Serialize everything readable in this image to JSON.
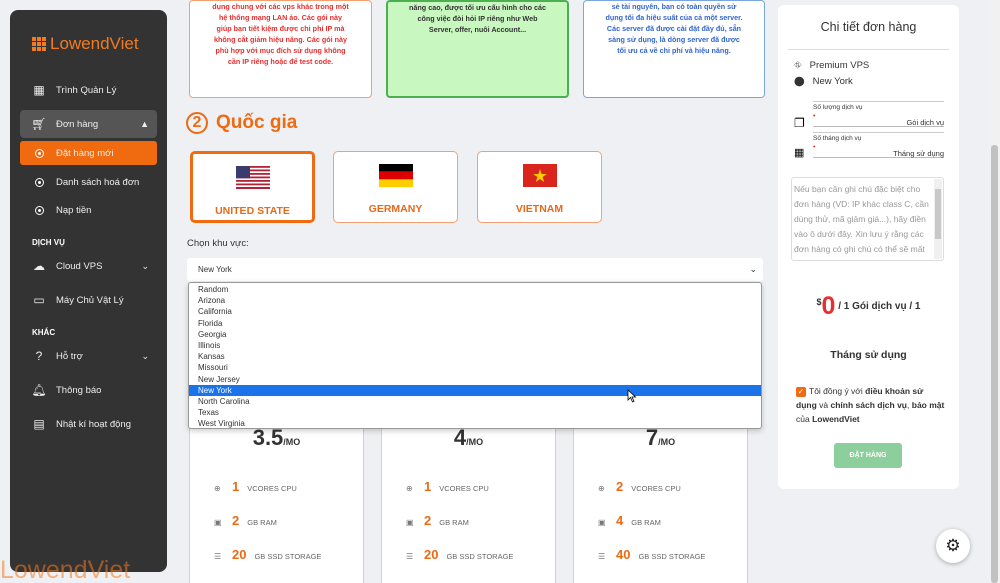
{
  "sidebar": {
    "logo": "LowendViet",
    "items": [
      {
        "label": "Trình Quản Lý",
        "icon": "dashboard-icon"
      },
      {
        "label": "Đơn hàng",
        "icon": "cart-icon"
      },
      {
        "label": "Đặt hàng mới",
        "icon": "radio-icon"
      },
      {
        "label": "Danh sách hoá đơn",
        "icon": "radio-icon"
      },
      {
        "label": "Nạp tiền",
        "icon": "radio-icon"
      },
      {
        "label": "Cloud VPS",
        "icon": "cloud-icon"
      },
      {
        "label": "Máy Chủ Vật Lý",
        "icon": "server-icon"
      },
      {
        "label": "Hỗ trợ",
        "icon": "help-icon"
      },
      {
        "label": "Thông báo",
        "icon": "bell-icon"
      },
      {
        "label": "Nhật kí hoạt động",
        "icon": "calendar-icon"
      }
    ],
    "sections": [
      "DỊCH VỤ",
      "KHÁC"
    ],
    "watermark": "LowendViet"
  },
  "plans_top": [
    {
      "lines": [
        "dụng chung với các vps khác trong một",
        "hệ thống mạng LAN ảo. Các gói này",
        "giúp bạn tiết kiệm được chi phí IP mà",
        "không cắt giảm hiệu năng. Các gói này",
        "phù hợp với mục đích sử dụng không",
        "cần IP riêng hoặc để test code."
      ],
      "color": "#e53030"
    },
    {
      "lines": [
        "năng cao, được tối ưu cấu hình cho các",
        "công việc đòi hỏi IP riêng như Web",
        "Server, offer, nuôi Account..."
      ],
      "color": "#333333"
    },
    {
      "lines": [
        "sẻ tài nguyên, bạn có toàn quyền sử",
        "dụng tối đa hiệu suất của cả một server.",
        "Các server đã được cài đặt đầy đủ, sẵn",
        "sàng sử dụng, là dòng server đã được",
        "tối ưu cả về chi phí và hiệu năng."
      ],
      "color": "#3366cc"
    }
  ],
  "country_section": {
    "number": "2",
    "title": "Quốc gia"
  },
  "countries": [
    {
      "name": "UNITED STATE",
      "flag": "us-flag-icon",
      "selected": true
    },
    {
      "name": "GERMANY",
      "flag": "de-flag-icon",
      "selected": false
    },
    {
      "name": "VIETNAM",
      "flag": "vn-flag-icon",
      "selected": false
    }
  ],
  "region": {
    "label": "Chọn khu vực:",
    "selected": "New York",
    "options": [
      "Random",
      "Arizona",
      "California",
      "Florida",
      "Georgia",
      "Illinois",
      "Kansas",
      "Missouri",
      "New Jersey",
      "New York",
      "North Carolina",
      "Texas",
      "West Virginia"
    ]
  },
  "packages": [
    {
      "price": "3.5",
      "unit": "/MO",
      "cpu": "1",
      "ram": "2",
      "storage": "20"
    },
    {
      "price": "4",
      "unit": "/MO",
      "cpu": "1",
      "ram": "2",
      "storage": "20"
    },
    {
      "price": "7",
      "unit": "/MO",
      "cpu": "2",
      "ram": "4",
      "storage": "40"
    }
  ],
  "spec_labels": {
    "cpu": "VCORES CPU",
    "ram": "GB RAM",
    "storage": "GB SSD STORAGE"
  },
  "order_detail": {
    "title": "Chi tiết đơn hàng",
    "product": "Premium VPS",
    "location": "New York",
    "qty_label": "Số lượng dịch vụ",
    "qty_value": "Gói dịch vụ",
    "months_label": "Số tháng dịch vụ",
    "months_value": "Tháng sử dụng",
    "note_placeholder": "Nếu bạn cần ghi chú đặc biệt cho đơn hàng (VD: IP khác class C, cần dùng thử, mã giảm giá...), hãy điền vào ô dưới đây. Xin lưu ý rằng các đơn hàng có ghi chú có thể sẽ mất nhiều thời gian xử lý hơn.",
    "currency": "$",
    "total": "0",
    "per_unit": "/ 1 Gói dịch vụ / 1",
    "period": "Tháng sử dụng",
    "agree_parts": [
      "Tôi đồng ý với ",
      "điều khoản sử dụng",
      " và ",
      "chính sách dịch vụ",
      ", ",
      "bảo mật",
      " của ",
      "LowendViet"
    ],
    "order_button": "ĐẶT HÀNG"
  },
  "colors": {
    "accent": "#f06a10",
    "sidebar": "#333333",
    "order_button": "#8ccf9c"
  }
}
